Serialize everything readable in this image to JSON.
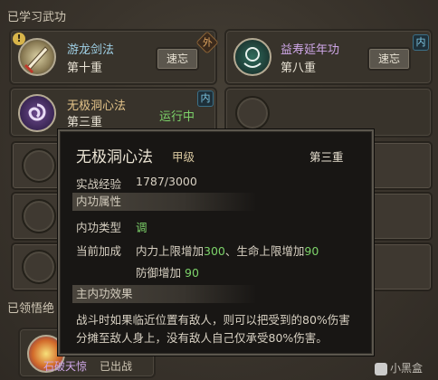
{
  "sections": {
    "learned": "已学习武功",
    "comprehended": "已领悟绝"
  },
  "skills": [
    {
      "name": "游龙剑法",
      "level": "第十重",
      "button": "速忘",
      "badge": "外"
    },
    {
      "name": "益寿延年功",
      "level": "第八重",
      "button": "速忘",
      "badge": "内"
    },
    {
      "name": "无极洞心法",
      "level": "第三重",
      "status": "运行中",
      "badge": "内"
    }
  ],
  "bottom_card": {
    "name": "石破天惊",
    "status": "已出战"
  },
  "tooltip": {
    "title": "无极洞心法",
    "grade": "甲级",
    "level": "第三重",
    "exp_label": "实战经验",
    "exp_value": "1787/3000",
    "attr_header": "内功属性",
    "type_label": "内功类型",
    "type_value": "调",
    "bonus_label": "当前加成",
    "bonus_line1_a": "内力上限增加",
    "bonus_line1_b": "300",
    "bonus_line1_c": "、生命上限增加",
    "bonus_line1_d": "90",
    "bonus_line2_a": "防御增加",
    "bonus_line2_b": "90",
    "effect_header": "主内功效果",
    "effect_line1": "战斗时如果临近位置有敌人，则可以把受到的80%伤害",
    "effect_line2": "分摊至敌人身上，没有敌人自己仅承受80%伤害。"
  },
  "watermark": "小黑盒",
  "colors": {
    "accent_green": "#7dd36a",
    "skill_blue": "#9fd0e6",
    "skill_gold": "#e4c48a"
  }
}
